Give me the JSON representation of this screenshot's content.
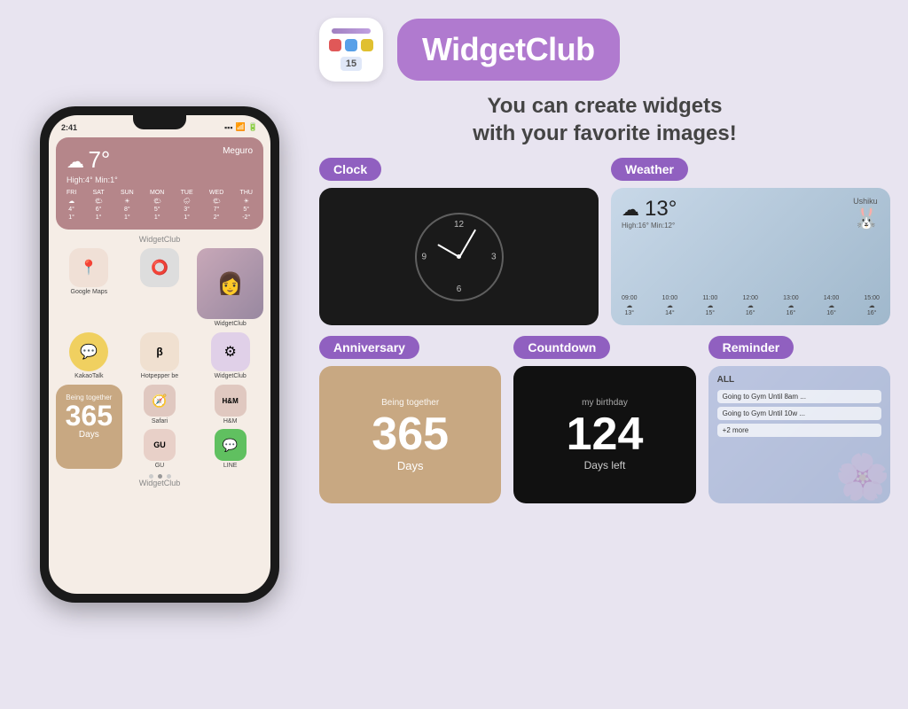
{
  "phone": {
    "time": "2:41",
    "weather": {
      "temp": "7°",
      "location": "Meguro",
      "high_min": "High:4° Min:1°",
      "days": [
        {
          "label": "FRI",
          "icon": "☁",
          "high": "4°",
          "low": "1°"
        },
        {
          "label": "SAT",
          "icon": "🌤",
          "high": "6°",
          "low": "1°"
        },
        {
          "label": "SUN",
          "icon": "☀",
          "high": "8°",
          "low": "1°"
        },
        {
          "label": "MON",
          "icon": "🌤",
          "high": "5°",
          "low": "1°"
        },
        {
          "label": "TUE",
          "icon": "🌧",
          "high": "3°",
          "low": "1°"
        },
        {
          "label": "WED",
          "icon": "🌤",
          "high": "7°",
          "low": "2°"
        },
        {
          "label": "THU",
          "icon": "☀",
          "high": "5°",
          "low": "-2°"
        }
      ]
    },
    "widgetclub_label": "WidgetClub",
    "apps": [
      {
        "label": "Google Maps",
        "icon": "📍"
      },
      {
        "label": "",
        "icon": "🔘"
      },
      {
        "label": "WidgetClub",
        "icon": "📸"
      }
    ],
    "apps2": [
      {
        "label": "KakaoTalk",
        "icon": "💬"
      },
      {
        "label": "Hotpepper be",
        "icon": "β"
      },
      {
        "label": "WidgetClub",
        "icon": "⚙"
      }
    ],
    "anniversary": {
      "label": "Being together",
      "number": "365",
      "unit": "Days"
    },
    "small_apps": [
      {
        "label": "Safari",
        "icon": "🧭"
      },
      {
        "label": "H&M",
        "icon": "H&M"
      },
      {
        "label": "GU",
        "icon": "GU"
      },
      {
        "label": "LINE",
        "icon": "💬"
      }
    ],
    "bottom_label": "WidgetClub"
  },
  "app": {
    "name": "WidgetClub",
    "tagline_1": "You can create widgets",
    "tagline_2": "with your favorite images!"
  },
  "widgets": {
    "clock": {
      "tag": "Clock"
    },
    "weather": {
      "tag": "Weather",
      "temp": "13°",
      "location": "Ushiku",
      "high_min": "High:16° Min:12°",
      "times": [
        "09:00",
        "10:00",
        "11:00",
        "12:00",
        "13:00",
        "14:00",
        "15:00"
      ],
      "temps": [
        "13°",
        "14°",
        "15°",
        "16°",
        "16°",
        "16°",
        "16°"
      ]
    },
    "anniversary": {
      "tag": "Anniversary",
      "label": "Being together",
      "number": "365",
      "unit": "Days"
    },
    "countdown": {
      "tag": "Countdown",
      "label": "my birthday",
      "number": "124",
      "unit": "Days left"
    },
    "reminder": {
      "tag": "Reminder",
      "all_label": "ALL",
      "items": [
        "Going to Gym Until 8am ...",
        "Going to Gym Until 10w ...",
        "+2 more"
      ]
    }
  }
}
